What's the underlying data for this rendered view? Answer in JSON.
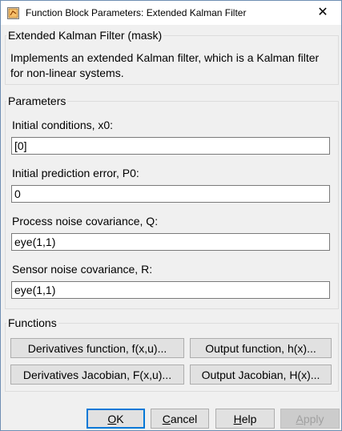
{
  "window": {
    "title": "Function Block Parameters: Extended Kalman Filter",
    "close_glyph": "✕"
  },
  "mask": {
    "header": "Extended Kalman Filter (mask)",
    "description": "Implements an extended Kalman filter, which is a Kalman filter for non-linear systems."
  },
  "parameters": {
    "header": "Parameters",
    "fields": [
      {
        "label": "Initial conditions, x0:",
        "value": "[0]"
      },
      {
        "label": "Initial prediction error, P0:",
        "value": "0"
      },
      {
        "label": "Process noise covariance, Q:",
        "value": "eye(1,1)"
      },
      {
        "label": "Sensor noise covariance, R:",
        "value": "eye(1,1)"
      }
    ]
  },
  "functions": {
    "header": "Functions",
    "derivatives_function": "Derivatives function, f(x,u)...",
    "output_function": "Output function, h(x)...",
    "derivatives_jacobian": "Derivatives Jacobian, F(x,u)...",
    "output_jacobian": "Output Jacobian, H(x)..."
  },
  "buttons": {
    "ok": {
      "underlined": "O",
      "rest": "K"
    },
    "cancel": {
      "underlined": "C",
      "rest": "ancel"
    },
    "help": {
      "underlined": "H",
      "rest": "elp"
    },
    "apply": {
      "underlined": "A",
      "rest": "pply",
      "enabled": false
    }
  },
  "colors": {
    "accent": "#0078d7",
    "dialog_background": "#f0f0f0"
  }
}
